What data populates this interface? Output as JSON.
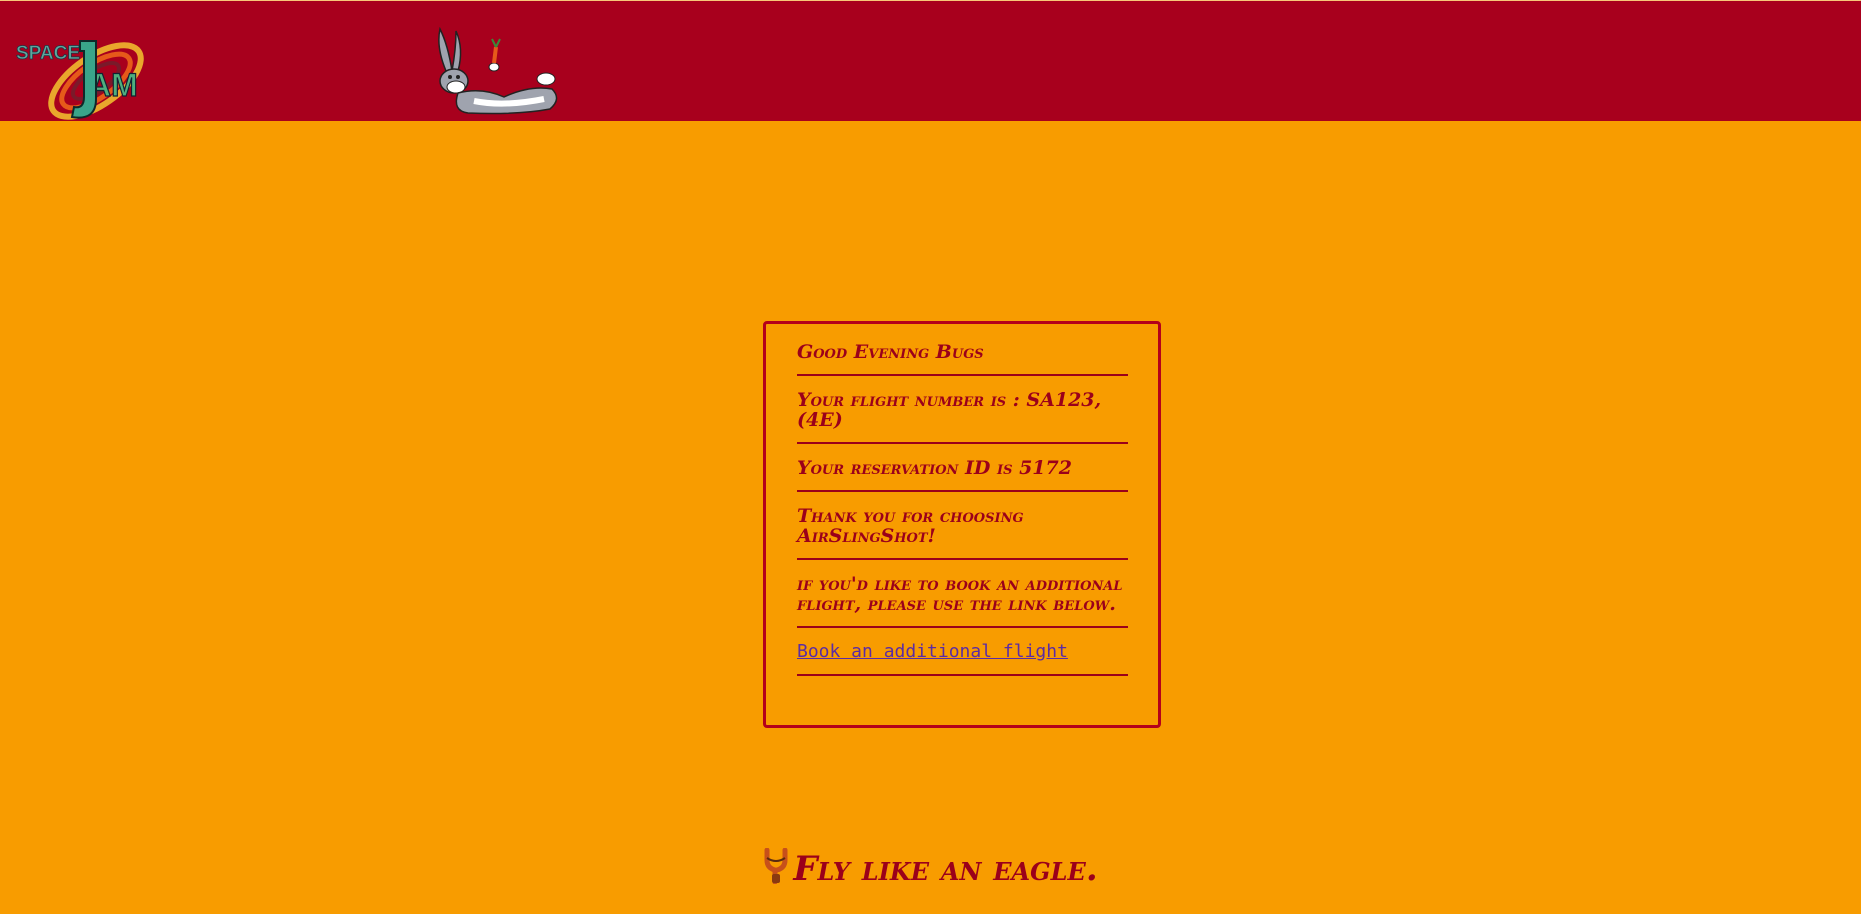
{
  "header": {
    "logo_icon": "space-jam-logo",
    "mascot_icon": "bugs-bunny-illustration",
    "colors": {
      "header_bg": "#a8001d",
      "page_bg": "#f89c00",
      "text": "#9b001a",
      "link": "#5b2ca4"
    }
  },
  "confirmation": {
    "greeting": "Good Evening Bugs",
    "flight_number": "Your flight number is : SA123, (4E)",
    "reservation": "Your reservation ID is 5172",
    "thanks": "Thank you for choosing AirSlingShot!",
    "book_again_hint": "if you'd like to book an additional flight, please use the link below.",
    "book_again_link": "Book an additional flight"
  },
  "footer": {
    "slogan": "Fly like an eagle.",
    "icon": "slingshot-icon"
  }
}
